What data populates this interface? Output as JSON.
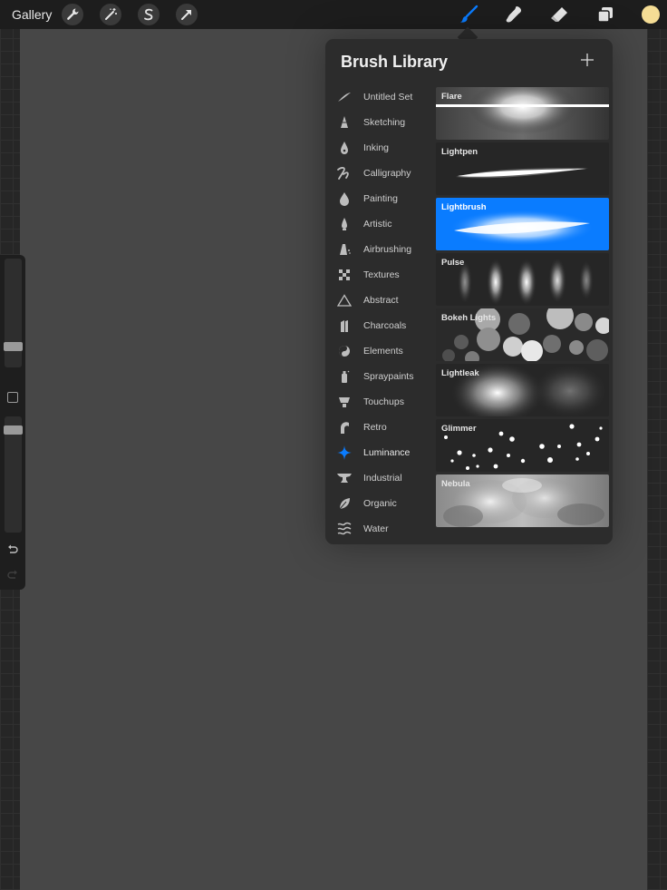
{
  "topbar": {
    "gallery_label": "Gallery",
    "left_icons": [
      "wrench-icon",
      "magic-wand-icon",
      "selection-s-icon",
      "transform-arrow-icon"
    ],
    "right_icons": [
      "brush-icon",
      "smudge-icon",
      "eraser-icon",
      "layers-icon"
    ],
    "active_tool": "brush",
    "accent_color": "#0a7cff",
    "current_color": "#f5dd95"
  },
  "library": {
    "title": "Brush Library",
    "add_icon": "plus-icon",
    "sets": [
      {
        "label": "Untitled Set",
        "icon": "stroke-icon"
      },
      {
        "label": "Sketching",
        "icon": "pencil-tip-icon"
      },
      {
        "label": "Inking",
        "icon": "ink-pen-icon"
      },
      {
        "label": "Calligraphy",
        "icon": "calligraphy-icon"
      },
      {
        "label": "Painting",
        "icon": "paint-drop-icon"
      },
      {
        "label": "Artistic",
        "icon": "brush-tip-icon"
      },
      {
        "label": "Airbrushing",
        "icon": "airbrush-icon"
      },
      {
        "label": "Textures",
        "icon": "checker-icon"
      },
      {
        "label": "Abstract",
        "icon": "triangle-icon"
      },
      {
        "label": "Charcoals",
        "icon": "charcoal-icon"
      },
      {
        "label": "Elements",
        "icon": "yin-yang-icon"
      },
      {
        "label": "Spraypaints",
        "icon": "spraycan-icon"
      },
      {
        "label": "Touchups",
        "icon": "touchup-icon"
      },
      {
        "label": "Retro",
        "icon": "retro-icon"
      },
      {
        "label": "Luminance",
        "icon": "sparkle-icon"
      },
      {
        "label": "Industrial",
        "icon": "anvil-icon"
      },
      {
        "label": "Organic",
        "icon": "leaf-icon"
      },
      {
        "label": "Water",
        "icon": "waves-icon"
      }
    ],
    "active_set": "Luminance",
    "brushes": [
      {
        "name": "Flare"
      },
      {
        "name": "Lightpen"
      },
      {
        "name": "Lightbrush"
      },
      {
        "name": "Pulse"
      },
      {
        "name": "Bokeh Lights"
      },
      {
        "name": "Lightleak"
      },
      {
        "name": "Glimmer"
      },
      {
        "name": "Nebula"
      }
    ],
    "selected_brush": "Lightbrush"
  },
  "sidebar": {
    "size_slider_level": 0.82,
    "opacity_slider_level": 0.0,
    "undo_icon": "undo-icon",
    "redo_icon": "redo-icon"
  }
}
